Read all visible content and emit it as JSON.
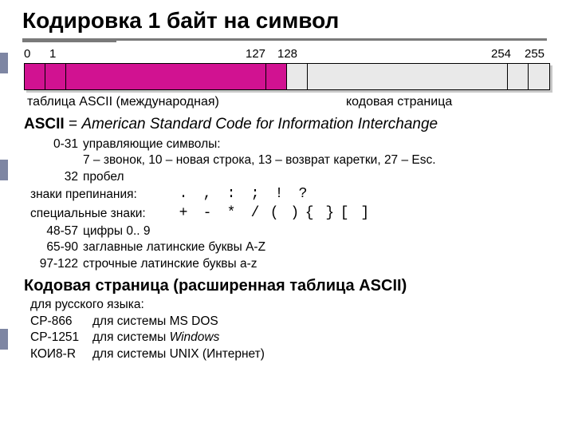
{
  "title": "Кодировка 1 байт на символ",
  "bar": {
    "n0": "0",
    "n1": "1",
    "n127": "127",
    "n128": "128",
    "n254": "254",
    "n255": "255",
    "label_left": "таблица ASCII (международная)",
    "label_right": "кодовая страница"
  },
  "ascii_def": {
    "b": "ASCII",
    "eq": " = ",
    "it": "American Standard Code for Information Interchange"
  },
  "details": {
    "r1_range": "0-31",
    "r1_text": "управляющие символы:",
    "r1_sub": "7 – звонок, 10 – новая строка, 13 – возврат каретки, 27 – Esc.",
    "r2_range": "32",
    "r2_text": "пробел",
    "punct_label": "знаки препинания:",
    "punct": [
      ".",
      ",",
      ":",
      ";",
      "!",
      "?"
    ],
    "spec_label": "специальные знаки:",
    "spec": [
      "+",
      "-",
      "*",
      "/",
      "( )",
      "{ }",
      "[ ]"
    ],
    "r3_range": "48-57",
    "r3_text": "цифры 0.. 9",
    "r4_range": "65-90",
    "r4_text": "заглавные латинские буквы A-Z",
    "r5_range": "97-122",
    "r5_text": "строчные латинские буквы a-z"
  },
  "codepage": {
    "heading": "Кодовая страница (расширенная таблица ASCII)",
    "ru": "для русского языка:",
    "cp866_name": "CP-866",
    "cp866_text": "для системы MS DOS",
    "cp1251_name": "CP-1251",
    "cp1251_text_a": "для системы ",
    "cp1251_text_b": "Windows",
    "koi8_name": "КОИ8-R",
    "koi8_text": "для системы UNIX (Интернет)"
  }
}
